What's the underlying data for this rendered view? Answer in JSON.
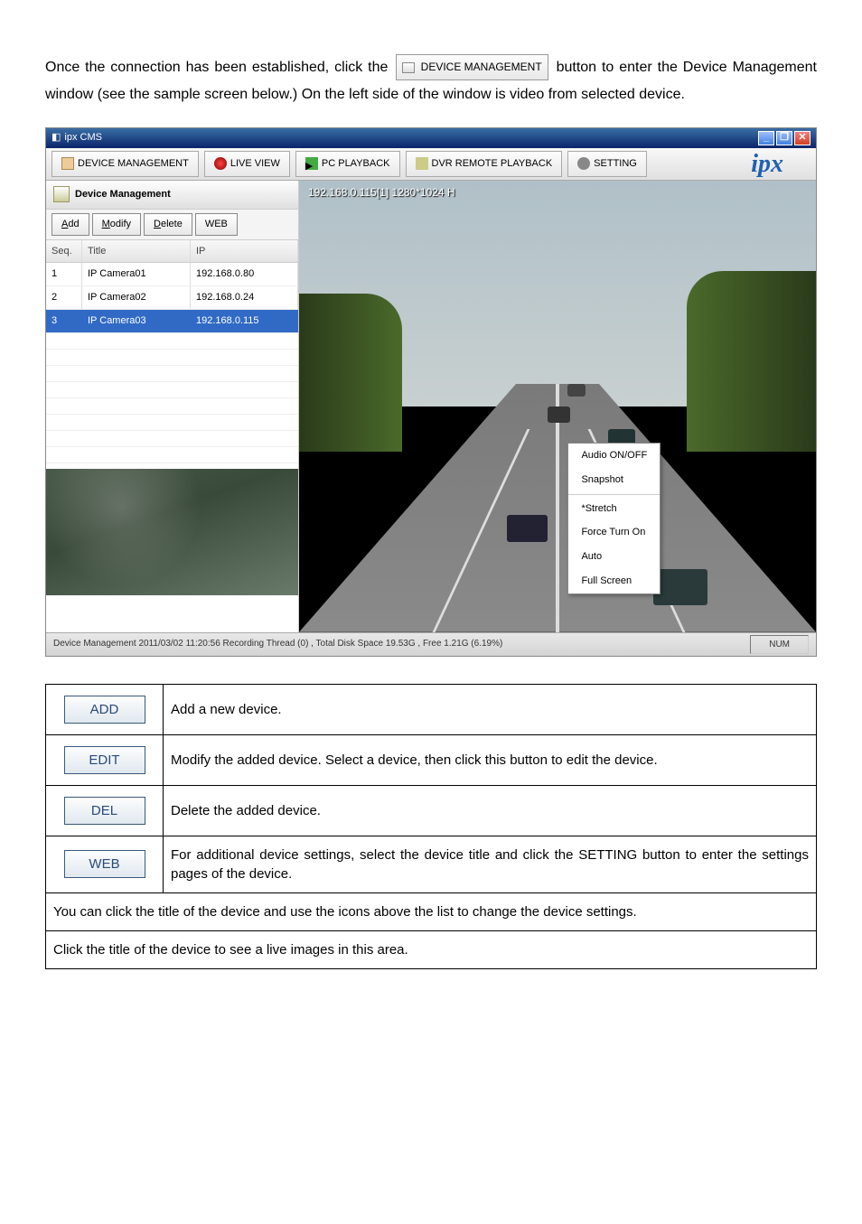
{
  "intro": {
    "part1": "Once the connection has been established, click the ",
    "btn_label": "DEVICE MANAGEMENT",
    "part2": " button to enter the Device Management window (see the sample screen below.) On the left side of the window is video from selected device."
  },
  "screenshot": {
    "window_title": "ipx CMS",
    "toolbar": {
      "device_mgmt": "DEVICE MANAGEMENT",
      "live_view": "LIVE VIEW",
      "pc_playback": "PC PLAYBACK",
      "dvr_remote": "DVR REMOTE PLAYBACK",
      "setting": "SETTING",
      "brand": "ipx"
    },
    "sidebar": {
      "header": "Device Management",
      "buttons": {
        "add": "Add",
        "modify": "Modify",
        "delete": "Delete",
        "web": "WEB"
      },
      "table_head": {
        "seq": "Seq.",
        "title": "Title",
        "ip": "IP"
      },
      "rows": [
        {
          "seq": "1",
          "title": "IP Camera01",
          "ip": "192.168.0.80"
        },
        {
          "seq": "2",
          "title": "IP Camera02",
          "ip": "192.168.0.24"
        },
        {
          "seq": "3",
          "title": "IP Camera03",
          "ip": "192.168.0.115"
        }
      ]
    },
    "main_label": "192.168.0.115[1] 1280*1024 H",
    "context_menu": {
      "audio": "Audio ON/OFF",
      "snapshot": "Snapshot",
      "stretch": "*Stretch",
      "force": "Force Turn On",
      "auto": "Auto",
      "full": "Full Screen"
    },
    "statusbar": {
      "left": "Device Management  2011/03/02 11:20:56  Recording Thread (0) , Total Disk Space 19.53G , Free 1.21G (6.19%)",
      "right": "NUM"
    }
  },
  "buttons_table": [
    {
      "label": "ADD",
      "desc": "Add a new device."
    },
    {
      "label": "EDIT",
      "desc": "Modify the added device. Select a device, then click this button to edit the device."
    },
    {
      "label": "DEL",
      "desc": "Delete the added device."
    },
    {
      "label": "WEB",
      "desc": "For additional device settings, select the device title and click the SETTING button to enter the settings pages of the device."
    }
  ],
  "notes": [
    "You can click the title of the device and use the icons above the list to change the device settings.",
    "Click the title of the device to see a live images in this area."
  ]
}
